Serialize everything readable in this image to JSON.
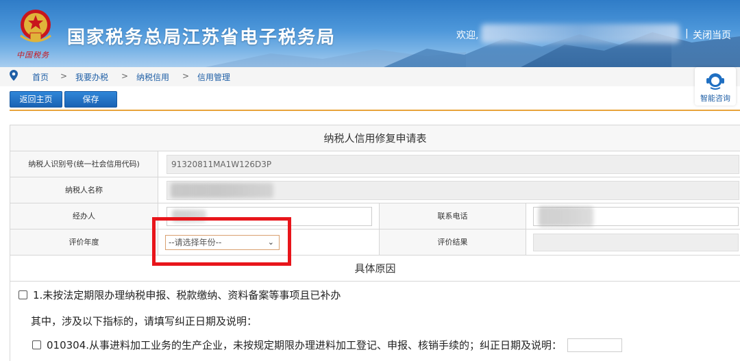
{
  "header": {
    "emblem_signature": "中国税务",
    "title": "国家税务总局江苏省电子税务局",
    "welcome": "欢迎,",
    "separator": "|",
    "close_link": "关闭当页"
  },
  "breadcrumb": {
    "items": [
      "首页",
      "我要办税",
      "纳税信用",
      "信用管理"
    ],
    "separator": ">"
  },
  "assistant": {
    "label": "智能咨询"
  },
  "toolbar": {
    "home_label": "返回主页",
    "save_label": "保存"
  },
  "form": {
    "title": "纳税人信用修复申请表",
    "taxpayer_id_label": "纳税人识别号(统一社会信用代码)",
    "taxpayer_id_value": "91320811MA1W126D3P",
    "taxpayer_name_label": "纳税人名称",
    "agent_label": "经办人",
    "phone_label": "联系电话",
    "eval_year_label": "评价年度",
    "eval_year_placeholder": "--请选择年份--",
    "eval_result_label": "评价结果",
    "reasons_section": "具体原因",
    "reason_1": "1.未按法定期限办理纳税申报、税款缴纳、资料备案等事项且已补办",
    "reason_1_note": "其中，涉及以下指标的，请填写纠正日期及说明：",
    "reason_1_sub": "010304.从事进料加工业务的生产企业，未按规定期限办理进料加工登记、申报、核销手续的；纠正日期及说明："
  },
  "colors": {
    "header_blue": "#2f7cc7",
    "link_blue": "#1f5fa6",
    "highlight_red": "#e8151b",
    "accent_orange": "#e8a33a"
  }
}
